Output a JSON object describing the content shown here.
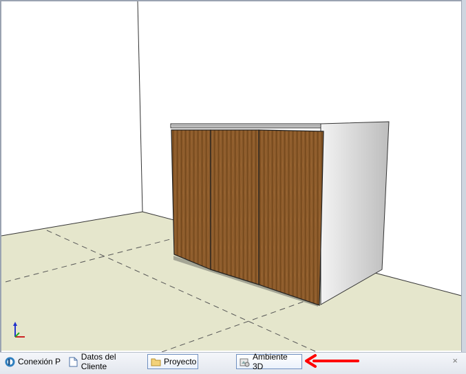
{
  "tabs": [
    {
      "label": "Conexión P",
      "icon": "conexion-icon",
      "active": false
    },
    {
      "label": "Datos del Cliente",
      "icon": "document-icon",
      "active": false
    },
    {
      "label": "Proyecto",
      "icon": "folder-icon",
      "active": true
    },
    {
      "label": "Ambiente 3D",
      "icon": "ambiente-3d-icon",
      "active": true
    }
  ],
  "close_label": "×",
  "colors": {
    "floor": "#e5e6cc",
    "wood": "#8a5a2b",
    "cabinet_side": "#d9d9d9",
    "annotation_arrow": "#ff0000"
  }
}
